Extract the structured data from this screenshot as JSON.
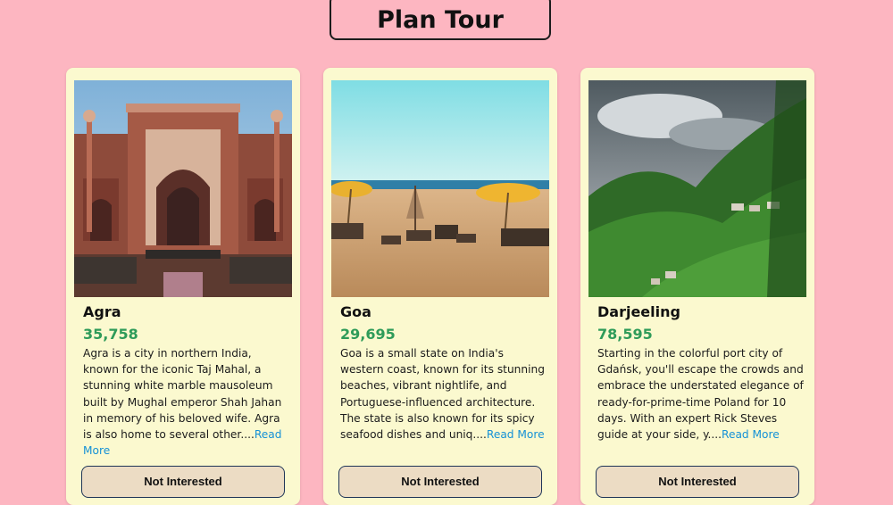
{
  "header": {
    "title": "Plan Tour"
  },
  "tours": [
    {
      "name": "Agra",
      "price": "35,758",
      "image": "taj-mahal-gate-image",
      "description": "Agra is a city in northern India, known for the iconic Taj Mahal, a stunning white marble mausoleum built by Mughal emperor Shah Jahan in memory of his beloved wife. Agra is also home to several other....",
      "read_more": "Read More",
      "button": "Not Interested"
    },
    {
      "name": "Goa",
      "price": "29,695",
      "image": "goa-beach-image",
      "description": "Goa is a small state on India's western coast, known for its stunning beaches, vibrant nightlife, and Portuguese-influenced architecture. The state is also known for its spicy seafood dishes and uniq....",
      "read_more": "Read More",
      "button": "Not Interested"
    },
    {
      "name": "Darjeeling",
      "price": "78,595",
      "image": "darjeeling-hills-image",
      "description": "Starting in the colorful port city of Gdańsk, you'll escape the crowds and embrace the understated elegance of ready-for-prime-time Poland for 10 days. With an expert Rick Steves guide at your side, y....",
      "read_more": "Read More",
      "button": "Not Interested"
    }
  ],
  "colors": {
    "background": "#fdb6c1",
    "card": "#fbf9cf",
    "price": "#2e9b59",
    "link": "#1591d6",
    "button": "#ecdcc4"
  }
}
